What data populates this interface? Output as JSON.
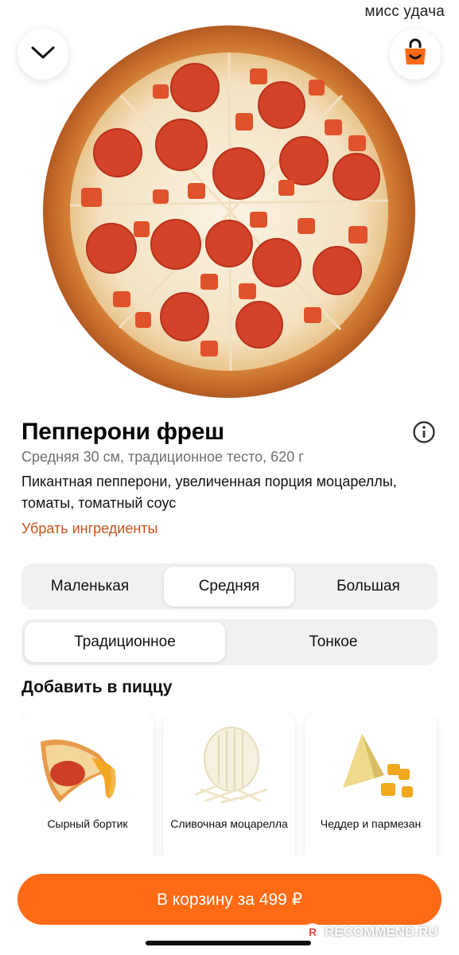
{
  "watermark_top": "мисс удача",
  "product": {
    "title": "Пепперони фреш",
    "subtitle": "Средняя 30 см, традиционное тесто, 620 г",
    "description": "Пикантная пепперони, увеличенная порция моцареллы, томаты, томатный соус",
    "remove_ingredients_link": "Убрать ингредиенты"
  },
  "size_options": [
    {
      "label": "Маленькая",
      "selected": false
    },
    {
      "label": "Средняя",
      "selected": true
    },
    {
      "label": "Большая",
      "selected": false
    }
  ],
  "dough_options": [
    {
      "label": "Традиционное",
      "selected": true
    },
    {
      "label": "Тонкое",
      "selected": false
    }
  ],
  "addons": {
    "title": "Добавить в пиццу",
    "items": [
      {
        "label": "Сырный бортик",
        "icon": "cheese-crust-image"
      },
      {
        "label": "Сливочная моцарелла",
        "icon": "mozzarella-image"
      },
      {
        "label": "Чеддер и пармезан",
        "icon": "cheddar-parmesan-image"
      }
    ]
  },
  "cta": {
    "label": "В корзину за 499 ₽"
  },
  "watermark_bottom": "RECOMMEND.RU",
  "watermark_bottom_badge": "R",
  "colors": {
    "accent": "#ff6a14",
    "link": "#c8531c",
    "segment_bg": "#f1f1f3"
  },
  "icons": {
    "collapse": "chevron-down-icon",
    "cart": "shopping-bag-icon",
    "info": "info-icon"
  }
}
